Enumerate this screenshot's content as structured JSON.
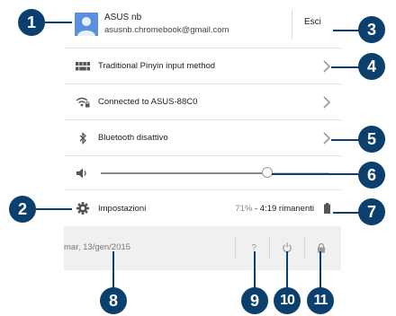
{
  "user": {
    "name": "ASUS nb",
    "email": "asusnb.chromebook@gmail.com",
    "signout_label": "Esci"
  },
  "rows": {
    "ime_label": "Traditional Pinyin input method",
    "network_label": "Connected to ASUS-88C0",
    "bluetooth_label": "Bluetooth disattivo",
    "settings_label": "Impostazioni"
  },
  "volume": {
    "level_percent": 73
  },
  "battery": {
    "percent_text": "71%",
    "separator": " - ",
    "time_text": "4:19 rimanenti"
  },
  "footer": {
    "date": "mar, 13/gen/2015",
    "help_label": "?"
  },
  "callouts": [
    "1",
    "2",
    "3",
    "4",
    "5",
    "6",
    "7",
    "8",
    "9",
    "10",
    "11"
  ],
  "colors": {
    "accent": "#0b3f6e",
    "avatar": "#5b8fe0",
    "footer_bg": "#f0f0f0"
  },
  "icons": [
    "user-avatar-icon",
    "keyboard-icon",
    "wifi-lock-icon",
    "bluetooth-icon",
    "volume-icon",
    "gear-icon",
    "battery-icon",
    "help-icon",
    "power-icon",
    "lock-icon",
    "chevron-right-icon"
  ]
}
